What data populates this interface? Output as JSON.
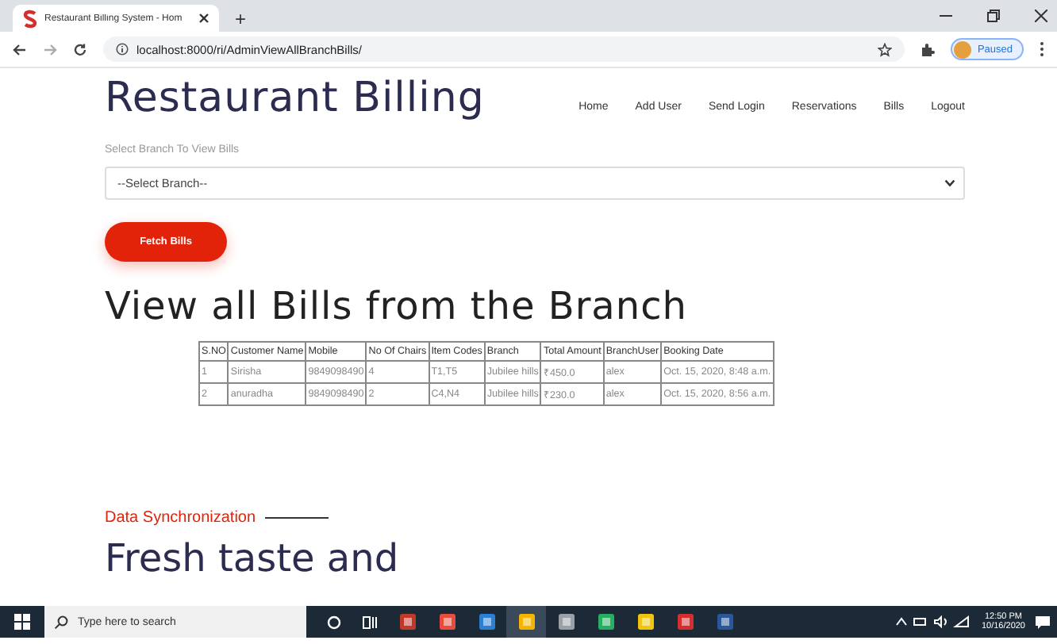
{
  "browser": {
    "tab_title": "Restaurant Billing System - Hom",
    "new_tab": "+",
    "url": "localhost:8000/ri/AdminViewAllBranchBills/",
    "profile": "Paused"
  },
  "header": {
    "brand": "Restaurant Billing",
    "nav": [
      "Home",
      "Add User",
      "Send Login",
      "Reservations",
      "Bills",
      "Logout"
    ]
  },
  "form": {
    "label": "Select Branch To View Bills",
    "select_value": "--Select Branch--",
    "button": "Fetch Bills"
  },
  "heading": "View all Bills from the Branch",
  "table": {
    "columns": [
      "S.NO",
      "Customer Name",
      "Mobile",
      "No Of Chairs",
      "Item Codes",
      "Branch",
      "Total Amount",
      "BranchUser",
      "Booking Date"
    ],
    "rows": [
      [
        "1",
        "Sirisha",
        "9849098490",
        "4",
        "T1,T5",
        "Jubilee hills",
        "₹450.0",
        "alex",
        "Oct. 15, 2020, 8:48 a.m."
      ],
      [
        "2",
        "anuradha",
        "9849098490",
        "2",
        "C4,N4",
        "Jubilee hills",
        "₹230.0",
        "alex",
        "Oct. 15, 2020, 8:56 a.m."
      ]
    ]
  },
  "section": {
    "eyebrow": "Data Synchronization",
    "title": "Fresh taste and"
  },
  "taskbar": {
    "search_placeholder": "Type here to search",
    "time": "12:50 PM",
    "date": "10/16/2020"
  }
}
